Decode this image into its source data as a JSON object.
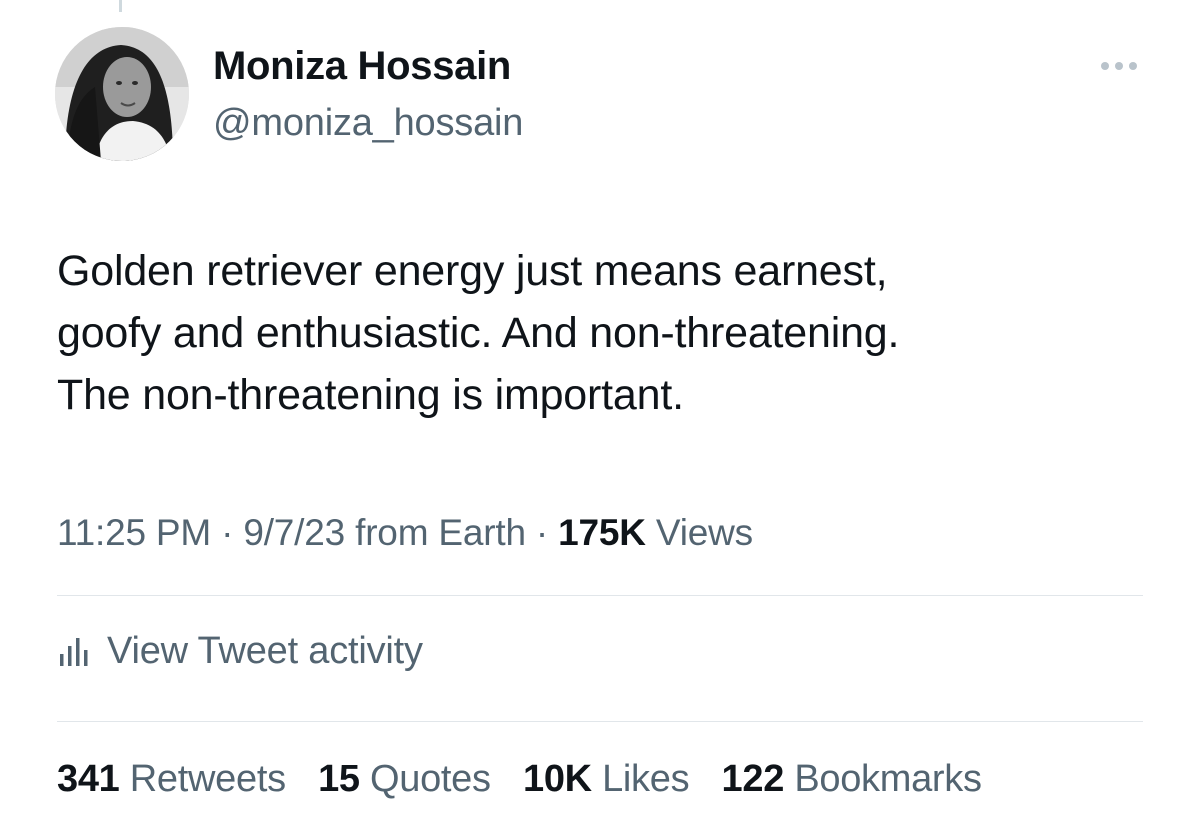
{
  "tweet": {
    "author": {
      "name": "Moniza Hossain",
      "handle": "@moniza_hossain"
    },
    "text_lines": [
      "Golden retriever energy just means earnest,",
      "goofy and enthusiastic. And non-threatening.",
      "The non-threatening is important."
    ],
    "meta": {
      "time": "11:25 PM",
      "date": "9/7/23",
      "source": "from Earth",
      "separator": "·",
      "views_count": "175K",
      "views_label": "Views"
    },
    "activity_label": "View Tweet activity",
    "stats": {
      "retweets": {
        "count": "341",
        "label": "Retweets"
      },
      "quotes": {
        "count": "15",
        "label": "Quotes"
      },
      "likes": {
        "count": "10K",
        "label": "Likes"
      },
      "bookmarks": {
        "count": "122",
        "label": "Bookmarks"
      }
    }
  },
  "icons": {
    "more": "more-horizontal-icon",
    "activity": "bar-chart-icon"
  },
  "colors": {
    "primary_text": "#0f1419",
    "secondary_text": "#536471",
    "divider": "#e1e6ea",
    "background": "#ffffff"
  }
}
